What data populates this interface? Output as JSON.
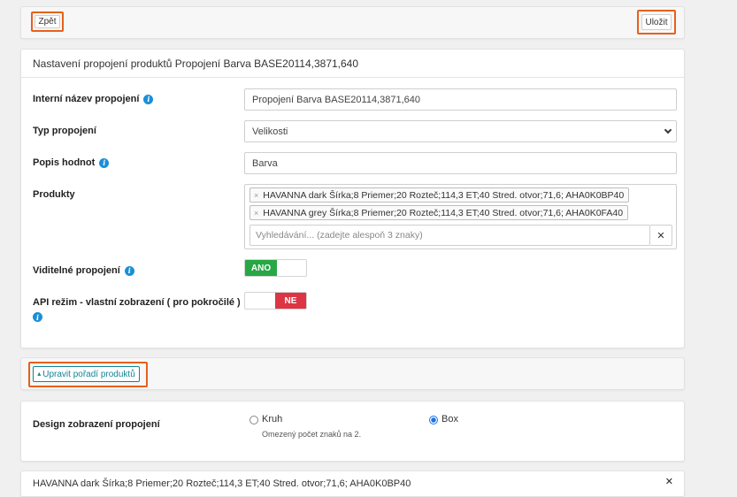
{
  "toolbar": {
    "back_label": "Zpět",
    "save_label": "Uložit"
  },
  "settings": {
    "heading": "Nastavení propojení produktů Propojení Barva BASE20114,3871,640",
    "internal_name_label": "Interní název propojení",
    "internal_name_value": "Propojení Barva BASE20114,3871,640",
    "type_label": "Typ propojení",
    "type_value": "Velikosti",
    "values_desc_label": "Popis hodnot",
    "values_desc_value": "Barva",
    "products_label": "Produkty",
    "products": [
      "HAVANNA dark Šírka;8 Priemer;20 Rozteč;114,3 ET;40 Stred. otvor;71,6; AHA0K0BP40",
      "HAVANNA grey Šírka;8 Priemer;20 Rozteč;114,3 ET;40 Stred. otvor;71,6; AHA0K0FA40"
    ],
    "tag_remove": "×",
    "search_placeholder": "Vyhledávání... (zadejte alespoň 3 znaky)",
    "search_clear": "✕",
    "visible_label": "Viditelné propojení",
    "visible_value": "ANO",
    "api_label": "API režim - vlastní zobrazení ( pro pokročilé )",
    "api_value": "NE"
  },
  "order": {
    "button_label": "Upravit pořadí produktů",
    "button_icon": "sort-icon"
  },
  "design": {
    "label": "Design zobrazení propojení",
    "option_circle": "Kruh",
    "option_circle_note": "Omezený počet znaků na 2.",
    "option_box": "Box",
    "selected": "Box"
  },
  "bottom_item": {
    "text": "HAVANNA dark Šírka;8 Priemer;20 Rozteč;114,3 ET;40 Stred. otvor;71,6; AHA0K0BP40",
    "close": "✕"
  },
  "colors": {
    "accent": "#e8601c",
    "success": "#28a745",
    "danger": "#dc3545",
    "info": "#1a8fd6",
    "teal": "#138496"
  }
}
